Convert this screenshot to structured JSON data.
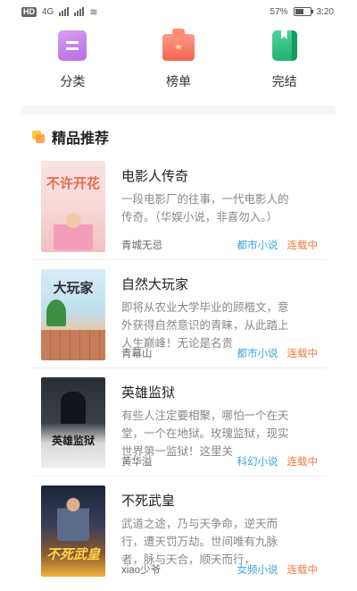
{
  "status_bar": {
    "network": "HD",
    "network2": "4G",
    "battery_percent": "57%",
    "battery_level": 0.57,
    "time": "3:20"
  },
  "categories": [
    {
      "label": "分类",
      "icon": "category-icon"
    },
    {
      "label": "榜单",
      "icon": "ranking-icon"
    },
    {
      "label": "完结",
      "icon": "finished-book-icon"
    }
  ],
  "section": {
    "title": "精品推荐",
    "icon": "recommend-icon"
  },
  "cover_texts": [
    "不许开花",
    "大玩家",
    "英雄监狱",
    "不死武皇"
  ],
  "books": [
    {
      "title": "电影人传奇",
      "desc": "一段电影厂的往事，一代电影人的传奇。（华娱小说，非喜勿入。）",
      "author": "青城无忌",
      "genre": "都市小说",
      "status": "连载中"
    },
    {
      "title": "自然大玩家",
      "desc": "即将从农业大学毕业的顾楷文，意外获得自然意识的青睐，从此踏上人生巅峰！无论是名贵",
      "author": "青幕山",
      "genre": "都市小说",
      "status": "连载中"
    },
    {
      "title": "英雄监狱",
      "desc": "有些人注定要相聚，哪怕一个在天堂，一个在地狱。玫瑰监狱，现实世界第一监狱！这里关",
      "author": "黄华溢",
      "genre": "科幻小说",
      "status": "连载中"
    },
    {
      "title": "不死武皇",
      "desc": "武道之途，乃与天争命，逆天而行，遭天罚万劫。世间唯有九脉者，脉与天合，顺天而行，",
      "author": "xiao少爷",
      "genre": "女频小说",
      "status": "连载中"
    }
  ],
  "colors": {
    "genre": "#3aa3e3",
    "status": "#f07b3f"
  }
}
